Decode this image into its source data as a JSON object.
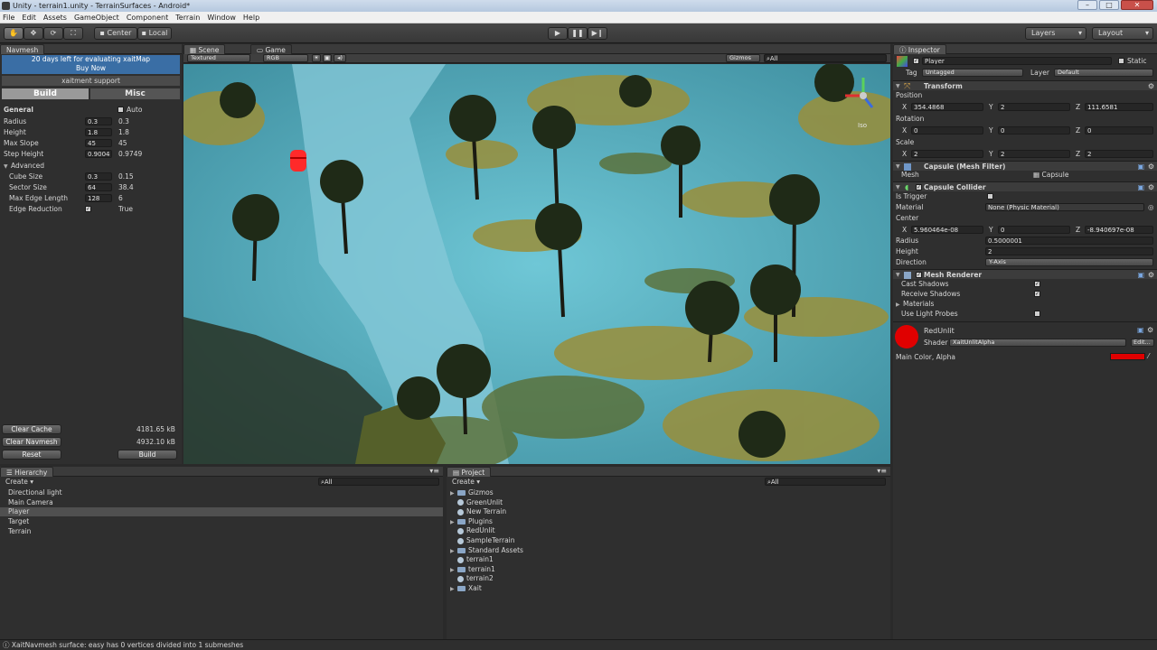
{
  "window": {
    "title": "Unity - terrain1.unity - TerrainSurfaces - Android*",
    "min": "–",
    "max": "□",
    "close": "✕"
  },
  "menu": [
    "File",
    "Edit",
    "Assets",
    "GameObject",
    "Component",
    "Terrain",
    "Window",
    "Help"
  ],
  "toolbar": {
    "pivot": "Center",
    "space": "Local",
    "play": "▶",
    "pause": "❚❚",
    "step": "▶❙",
    "layers": "Layers",
    "layout": "Layout"
  },
  "navmesh": {
    "tab": "Navmesh",
    "trial": "20 days left for evaluating xaitMap",
    "buy": "Buy Now",
    "support": "xaitment support",
    "tab_build": "Build",
    "tab_misc": "Misc",
    "general": "General",
    "auto": "Auto",
    "rows": [
      {
        "label": "Radius",
        "v1": "0.3",
        "v2": "0.3"
      },
      {
        "label": "Height",
        "v1": "1.8",
        "v2": "1.8"
      },
      {
        "label": "Max Slope",
        "v1": "45",
        "v2": "45"
      },
      {
        "label": "Step Height",
        "v1": "0.9004",
        "v2": "0.9749"
      }
    ],
    "advanced": "Advanced",
    "adv_rows": [
      {
        "label": "Cube Size",
        "v1": "0.3",
        "v2": "0.15"
      },
      {
        "label": "Sector Size",
        "v1": "64",
        "v2": "38.4"
      },
      {
        "label": "Max Edge Length",
        "v1": "128",
        "v2": "6"
      }
    ],
    "edge_reduction": "Edge Reduction",
    "edge_value": "True",
    "clear_cache": "Clear Cache",
    "cache_size": "4181.65 kB",
    "clear_navmesh": "Clear Navmesh",
    "navmesh_size": "4932.10 kB",
    "reset": "Reset",
    "build": "Build"
  },
  "scene": {
    "tab_scene": "Scene",
    "tab_game": "Game",
    "render_mode": "Textured",
    "color_mode": "RGB",
    "gizmos": "Gizmos",
    "search": "All",
    "gizmo_label": "Iso"
  },
  "hierarchy": {
    "tab": "Hierarchy",
    "create": "Create",
    "search": "All",
    "items": [
      "Directional light",
      "Main Camera",
      "Player",
      "Target",
      "Terrain"
    ],
    "selected": "Player"
  },
  "project": {
    "tab": "Project",
    "create": "Create",
    "search": "All",
    "items": [
      {
        "name": "Gizmos",
        "kind": "folder"
      },
      {
        "name": "GreenUnlit",
        "kind": "asset"
      },
      {
        "name": "New Terrain",
        "kind": "asset"
      },
      {
        "name": "Plugins",
        "kind": "folder"
      },
      {
        "name": "RedUnlit",
        "kind": "asset"
      },
      {
        "name": "SampleTerrain",
        "kind": "asset"
      },
      {
        "name": "Standard Assets",
        "kind": "folder"
      },
      {
        "name": "terrain1",
        "kind": "asset"
      },
      {
        "name": "terrain1",
        "kind": "folder"
      },
      {
        "name": "terrain2",
        "kind": "asset"
      },
      {
        "name": "Xait",
        "kind": "folder"
      }
    ]
  },
  "inspector": {
    "tab": "Inspector",
    "object_name": "Player",
    "static": "Static",
    "tag_label": "Tag",
    "tag": "Untagged",
    "layer_label": "Layer",
    "layer": "Default",
    "transform": "Transform",
    "position": "Position",
    "pos": {
      "x": "354.4868",
      "y": "2",
      "z": "111.6581"
    },
    "rotation": "Rotation",
    "rot": {
      "x": "0",
      "y": "0",
      "z": "0"
    },
    "scale": "Scale",
    "scl": {
      "x": "2",
      "y": "2",
      "z": "2"
    },
    "mesh_filter": "Capsule (Mesh Filter)",
    "mesh_label": "Mesh",
    "mesh": "Capsule",
    "collider": "Capsule Collider",
    "is_trigger": "Is Trigger",
    "material_label": "Material",
    "material": "None (Physic Material)",
    "center": "Center",
    "ctr": {
      "x": "5.960464e-08",
      "y": "0",
      "z": "-8.940697e-08"
    },
    "radius_label": "Radius",
    "radius": "0.5000001",
    "height_label": "Height",
    "height": "2",
    "direction_label": "Direction",
    "direction": "Y-Axis",
    "mesh_renderer": "Mesh Renderer",
    "cast_shadows": "Cast Shadows",
    "receive_shadows": "Receive Shadows",
    "materials": "Materials",
    "light_probes": "Use Light Probes",
    "mat_name": "RedUnlit",
    "shader_label": "Shader",
    "shader": "XaitUnlitAlpha",
    "edit": "Edit...",
    "main_color": "Main Color, Alpha",
    "main_color_hex": "#e00000"
  },
  "status": "XaitNavmesh surface: easy has 0 vertices divided into 1 submeshes"
}
